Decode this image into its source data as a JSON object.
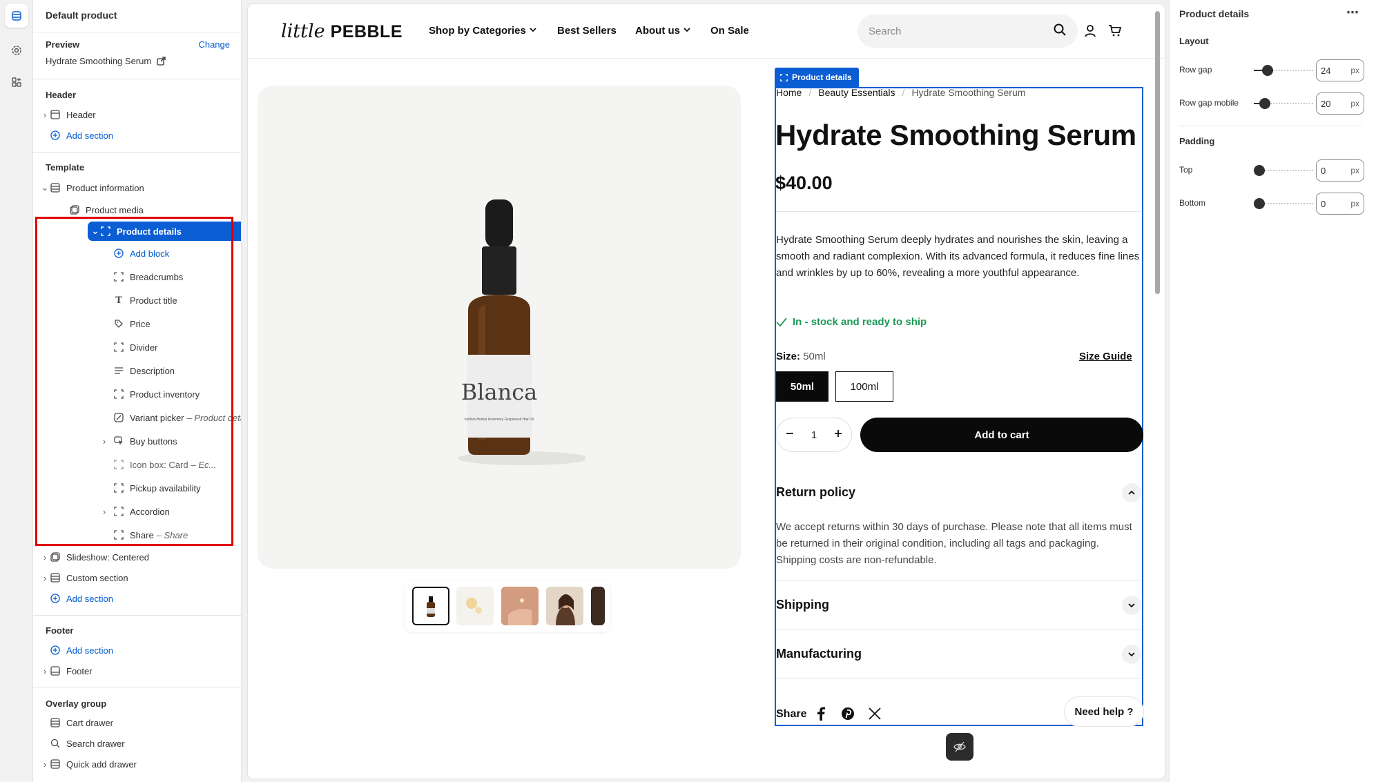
{
  "sidebar": {
    "title": "Default product",
    "preview_label": "Preview",
    "change_link": "Change",
    "preview_product": "Hydrate Smoothing Serum",
    "groups": {
      "header": "Header",
      "template": "Template",
      "footer": "Footer",
      "overlay": "Overlay group"
    },
    "header_items": [
      "Header",
      "Add section"
    ],
    "template_items": {
      "product_information": "Product information",
      "product_media": "Product media",
      "product_details": "Product details",
      "add_block": "Add block",
      "breadcrumbs": "Breadcrumbs",
      "product_title": "Product title",
      "price": "Price",
      "divider": "Divider",
      "description": "Description",
      "product_inventory": "Product inventory",
      "variant_picker": "Variant picker",
      "variant_picker_sub": "– Product details",
      "buy_buttons": "Buy buttons",
      "icon_box": "Icon box: Card",
      "icon_box_sub": "– Ec...",
      "pickup": "Pickup availability",
      "accordion": "Accordion",
      "share": "Share",
      "share_sub": "– Share",
      "slideshow": "Slideshow: Centered",
      "custom_section": "Custom section",
      "add_section": "Add section"
    },
    "footer_items": [
      "Add section",
      "Footer"
    ],
    "overlay_items": [
      "Cart drawer",
      "Search drawer",
      "Quick add drawer"
    ]
  },
  "store": {
    "logo_script": "little",
    "logo_bold": "PEBBLE",
    "nav": [
      "Shop by Categories",
      "Best Sellers",
      "About us",
      "On Sale"
    ],
    "search_placeholder": "Search"
  },
  "product": {
    "tag": "Product details",
    "breadcrumbs": [
      "Home",
      "Beauty Essentials",
      "Hydrate Smoothing Serum"
    ],
    "title": "Hydrate Smoothing Serum",
    "price": "$40.00",
    "description": "Hydrate Smoothing Serum deeply hydrates and nourishes the skin, leaving a smooth and radiant complexion. With its advanced formula, it reduces fine lines and wrinkles by up to 60%, revealing a more youthful appearance.",
    "stock": "In - stock and ready to ship",
    "size_label": "Size:",
    "size_value": "50ml",
    "size_guide": "Size Guide",
    "sizes": [
      "50ml",
      "100ml"
    ],
    "quantity": "1",
    "add_to_cart": "Add to cart",
    "accordions": [
      {
        "title": "Return policy",
        "body": "We accept returns within 30 days of purchase. Please note that all items must be returned in their original condition, including all tags and packaging. Shipping costs are non-refundable."
      },
      {
        "title": "Shipping"
      },
      {
        "title": "Manufacturing"
      }
    ],
    "share": "Share",
    "need_help": "Need help ?",
    "bottle_label": "Blanca",
    "bottle_small": "Iceflora Herbal Rosemary Grapeseed Hair Oil"
  },
  "settings": {
    "title": "Product details",
    "layout_heading": "Layout",
    "row_gap_label": "Row gap",
    "row_gap_value": "24",
    "row_gap_mobile_label": "Row gap mobile",
    "row_gap_mobile_value": "20",
    "padding_heading": "Padding",
    "top_label": "Top",
    "top_value": "0",
    "bottom_label": "Bottom",
    "bottom_value": "0",
    "unit": "px"
  },
  "colors": {
    "accent": "#0b5dd4",
    "highlight_box": "#e00000",
    "stock_green": "#1b9a55"
  }
}
